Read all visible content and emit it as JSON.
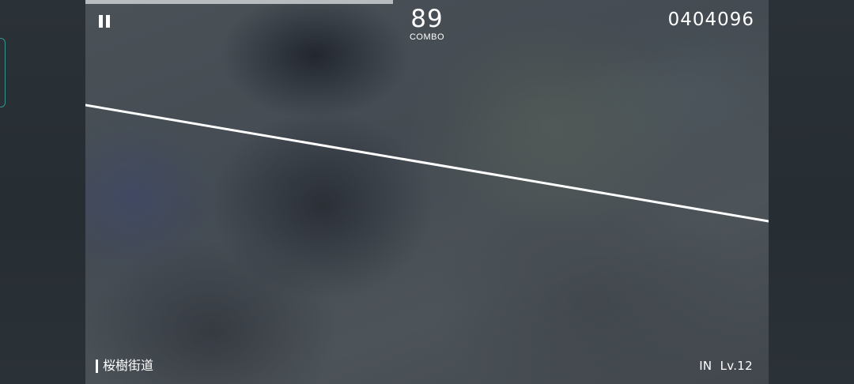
{
  "hud": {
    "combo": "89",
    "combo_label": "COMBO",
    "score": "0404096",
    "song_title": "桜樹街道",
    "difficulty": "IN  Lv.12",
    "progress": 0.45
  },
  "icons": {
    "pause": "pause-icon"
  },
  "colors": {
    "hud_text": "#ffffff",
    "judge_line": "#ffffff",
    "progress_bar": "#b9bcbf",
    "side_panel": "#2a3137",
    "accent": "#3fa39b"
  }
}
